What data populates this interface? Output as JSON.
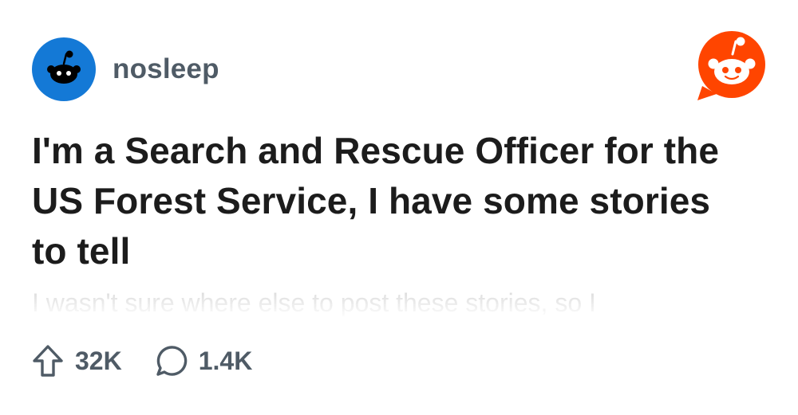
{
  "post": {
    "subreddit": "nosleep",
    "title": "I'm a Search and Rescue Officer for the US Forest Service, I have some stories to tell",
    "preview": "I wasn't sure where else to post these stories, so I",
    "upvotes": "32K",
    "comments": "1.4K"
  },
  "icons": {
    "subreddit_avatar": "snoo-avatar-icon",
    "brand_logo": "reddit-logo-icon",
    "upvote": "upvote-arrow-icon",
    "comment": "comment-bubble-icon"
  },
  "colors": {
    "avatar_bg": "#1479d6",
    "brand": "#ff4500",
    "title_text": "#1c1c1c",
    "meta_text": "#4f5b66"
  }
}
